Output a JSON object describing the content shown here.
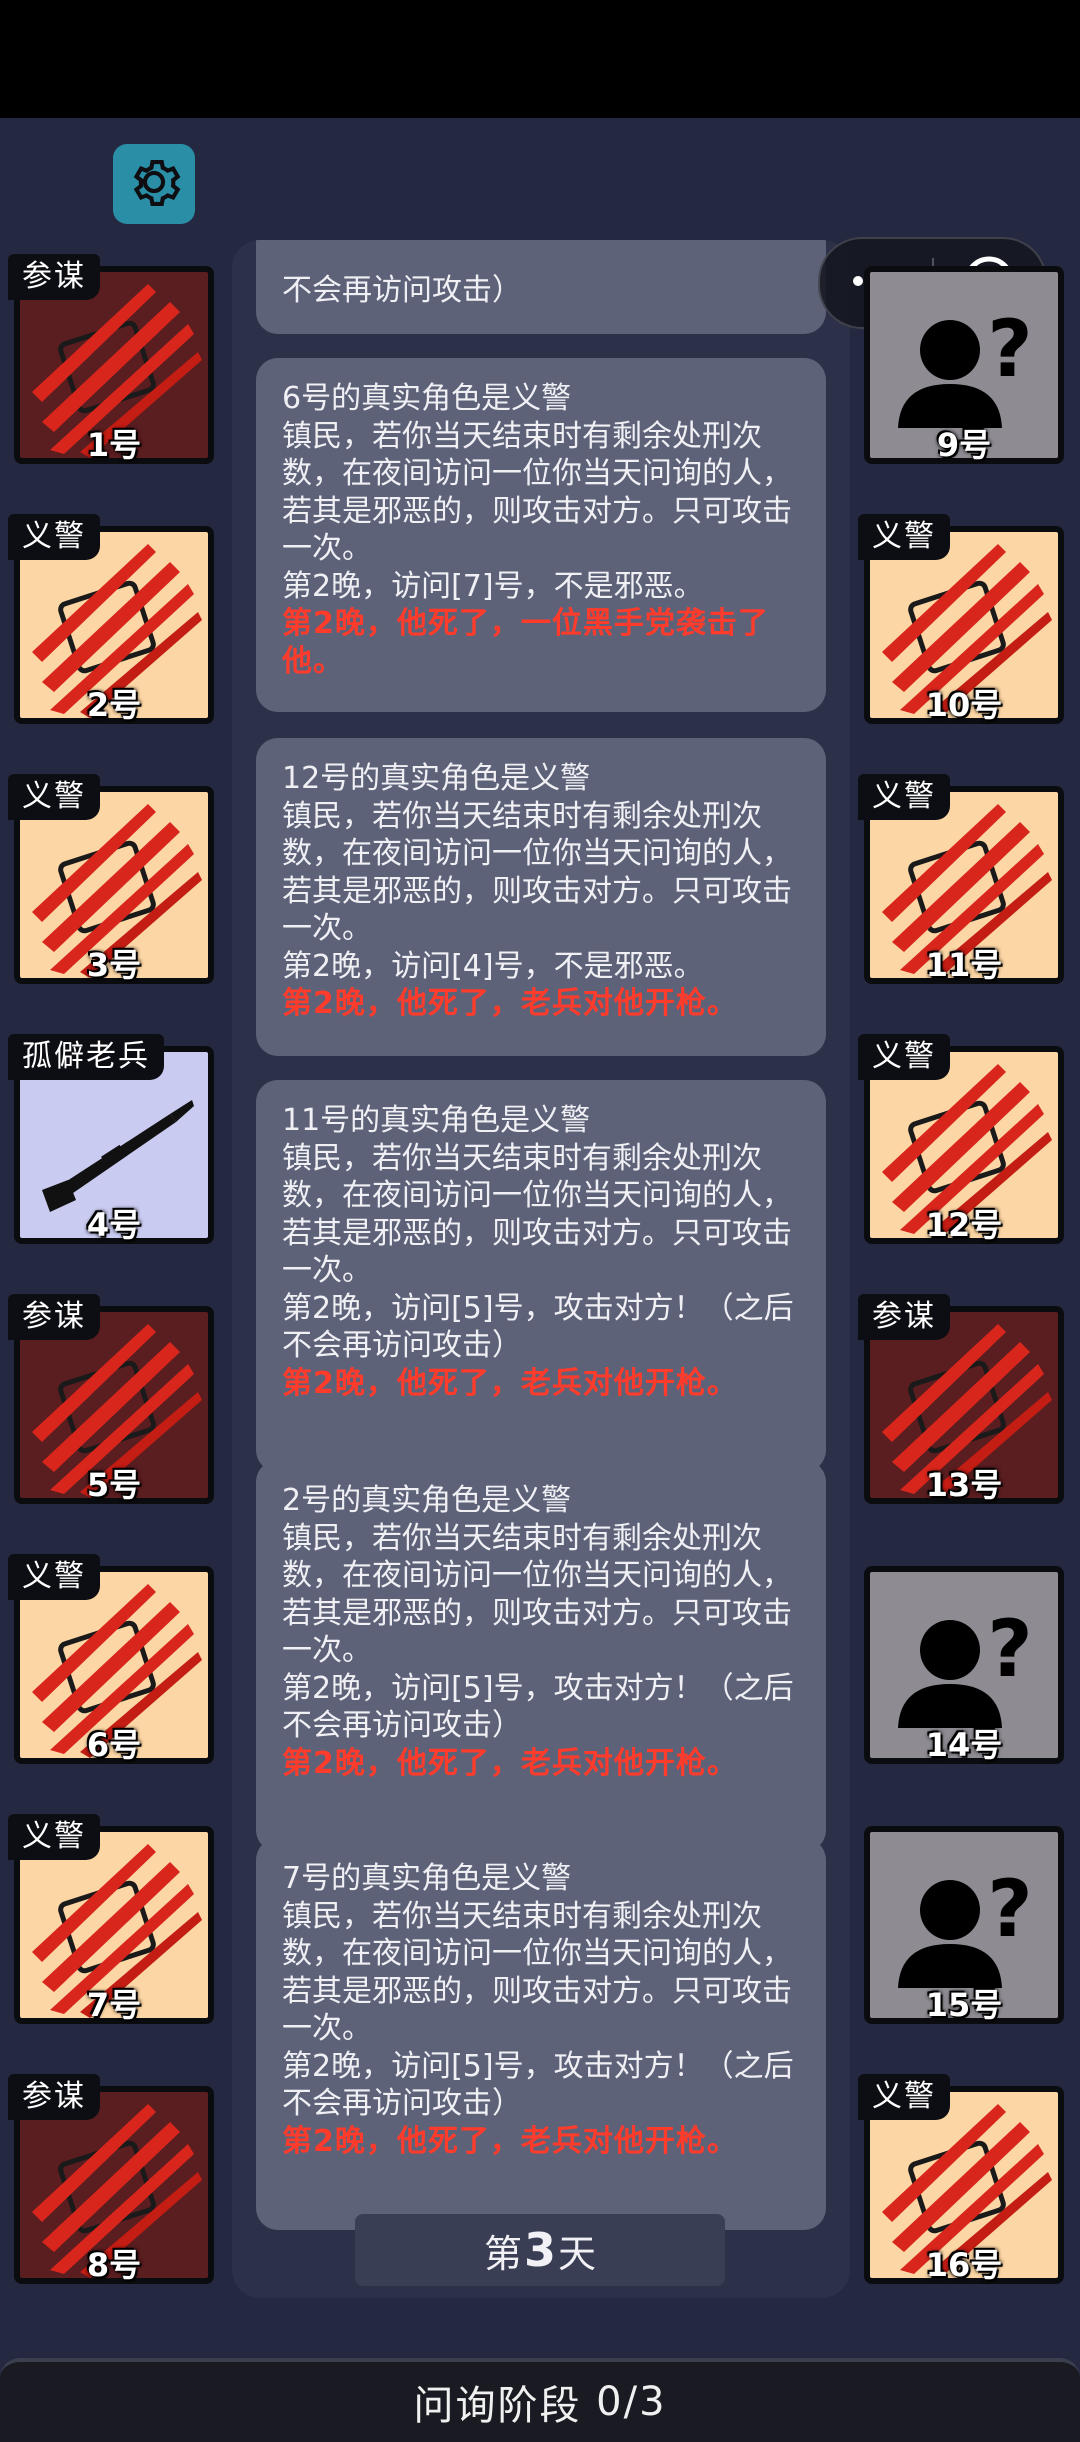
{
  "settings_icon": "gear-icon",
  "capsule": {
    "more_icon": "more-dots-icon",
    "close_icon": "target-close-icon"
  },
  "colors": {
    "background": "#242840",
    "card": "#5d6279",
    "death_text": "#ff3b2b",
    "settings": "#2a8fa6",
    "vigilante_tile": "#fcd6a4",
    "consultant_tile": "#5a1d20",
    "unknown_tile": "#8f8b92",
    "veteran_tile": "#c9cbf0"
  },
  "players_left": [
    {
      "number": "1号",
      "role": "参谋",
      "type": "consultant",
      "icon": "claw-mark-icon"
    },
    {
      "number": "2号",
      "role": "义警",
      "type": "vigilante",
      "icon": "claw-mark-icon"
    },
    {
      "number": "3号",
      "role": "义警",
      "type": "vigilante",
      "icon": "claw-mark-icon"
    },
    {
      "number": "4号",
      "role": "孤僻老兵",
      "type": "veteran",
      "icon": "rifle-icon"
    },
    {
      "number": "5号",
      "role": "参谋",
      "type": "consultant",
      "icon": "claw-mark-icon"
    },
    {
      "number": "6号",
      "role": "义警",
      "type": "vigilante",
      "icon": "claw-mark-icon"
    },
    {
      "number": "7号",
      "role": "义警",
      "type": "vigilante",
      "icon": "claw-mark-icon"
    },
    {
      "number": "8号",
      "role": "参谋",
      "type": "consultant",
      "icon": "claw-mark-icon"
    }
  ],
  "players_right": [
    {
      "number": "9号",
      "role": "",
      "type": "unknown",
      "icon": "unknown-person-icon"
    },
    {
      "number": "10号",
      "role": "义警",
      "type": "vigilante",
      "icon": "claw-mark-icon"
    },
    {
      "number": "11号",
      "role": "义警",
      "type": "vigilante",
      "icon": "claw-mark-icon"
    },
    {
      "number": "12号",
      "role": "义警",
      "type": "vigilante",
      "icon": "claw-mark-icon"
    },
    {
      "number": "13号",
      "role": "参谋",
      "type": "consultant",
      "icon": "claw-mark-icon"
    },
    {
      "number": "14号",
      "role": "",
      "type": "unknown",
      "icon": "unknown-person-icon"
    },
    {
      "number": "15号",
      "role": "",
      "type": "unknown",
      "icon": "unknown-person-icon"
    },
    {
      "number": "16号",
      "role": "义警",
      "type": "vigilante",
      "icon": "claw-mark-icon"
    }
  ],
  "log_cards": [
    {
      "lines": [
        "不会再访问攻击）"
      ],
      "death": ""
    },
    {
      "lines": [
        "6号的真实角色是义警",
        "镇民，若你当天结束时有剩余处刑次数，在夜间访问一位你当天问询的人，若其是邪恶的，则攻击对方。只可攻击一次。",
        "第2晚，访问[7]号，不是邪恶。"
      ],
      "death": "第2晚，他死了，一位黑手党袭击了他。"
    },
    {
      "lines": [
        "12号的真实角色是义警",
        "镇民，若你当天结束时有剩余处刑次数，在夜间访问一位你当天问询的人，若其是邪恶的，则攻击对方。只可攻击一次。",
        "第2晚，访问[4]号，不是邪恶。"
      ],
      "death": "第2晚，他死了，老兵对他开枪。"
    },
    {
      "lines": [
        "11号的真实角色是义警",
        "镇民，若你当天结束时有剩余处刑次数，在夜间访问一位你当天问询的人，若其是邪恶的，则攻击对方。只可攻击一次。",
        "第2晚，访问[5]号，攻击对方！（之后不会再访问攻击）"
      ],
      "death": "第2晚，他死了，老兵对他开枪。"
    },
    {
      "lines": [
        "2号的真实角色是义警",
        "镇民，若你当天结束时有剩余处刑次数，在夜间访问一位你当天问询的人，若其是邪恶的，则攻击对方。只可攻击一次。",
        "第2晚，访问[5]号，攻击对方！（之后不会再访问攻击）"
      ],
      "death": "第2晚，他死了，老兵对他开枪。"
    },
    {
      "lines": [
        "7号的真实角色是义警",
        "镇民，若你当天结束时有剩余处刑次数，在夜间访问一位你当天问询的人，若其是邪恶的，则攻击对方。只可攻击一次。",
        "第2晚，访问[5]号，攻击对方！（之后不会再访问攻击）"
      ],
      "death": "第2晚，他死了，老兵对他开枪。"
    }
  ],
  "day": {
    "prefix": "第",
    "number": "3",
    "suffix": "天"
  },
  "phase": {
    "label": "问询阶段",
    "progress": "0/3"
  }
}
